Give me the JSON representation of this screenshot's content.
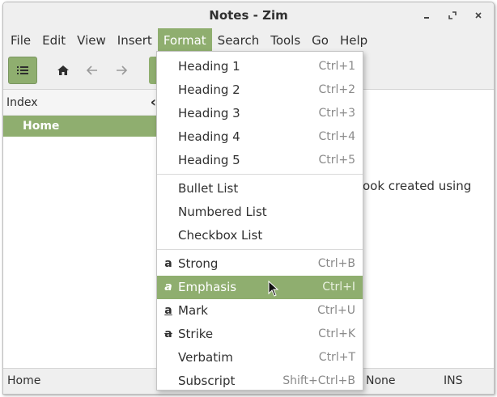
{
  "window": {
    "title": "Notes - Zim"
  },
  "menubar": {
    "items": [
      {
        "label": "File"
      },
      {
        "label": "Edit"
      },
      {
        "label": "View"
      },
      {
        "label": "Insert"
      },
      {
        "label": "Format"
      },
      {
        "label": "Search"
      },
      {
        "label": "Tools"
      },
      {
        "label": "Go"
      },
      {
        "label": "Help"
      }
    ],
    "active": "Format"
  },
  "toolbar": {
    "icons": [
      "list-icon",
      "home-icon",
      "back-arrow-icon",
      "forward-arrow-icon"
    ]
  },
  "index_pane": {
    "header": "Index",
    "pages": [
      {
        "label": "Home",
        "selected": true
      }
    ]
  },
  "editor": {
    "visible_text": "ook created using"
  },
  "statusbar": {
    "page": "Home",
    "style": "None",
    "mode": "INS"
  },
  "format_menu": {
    "groups": [
      [
        {
          "label": "Heading 1",
          "accel": "Ctrl+1"
        },
        {
          "label": "Heading 2",
          "accel": "Ctrl+2"
        },
        {
          "label": "Heading 3",
          "accel": "Ctrl+3"
        },
        {
          "label": "Heading 4",
          "accel": "Ctrl+4"
        },
        {
          "label": "Heading 5",
          "accel": "Ctrl+5"
        }
      ],
      [
        {
          "label": "Bullet List",
          "accel": ""
        },
        {
          "label": "Numbered List",
          "accel": ""
        },
        {
          "label": "Checkbox List",
          "accel": ""
        }
      ],
      [
        {
          "label": "Strong",
          "accel": "Ctrl+B",
          "icon": "strong-icon"
        },
        {
          "label": "Emphasis",
          "accel": "Ctrl+I",
          "icon": "emphasis-icon",
          "highlighted": true
        },
        {
          "label": "Mark",
          "accel": "Ctrl+U",
          "icon": "mark-icon"
        },
        {
          "label": "Strike",
          "accel": "Ctrl+K",
          "icon": "strike-icon"
        },
        {
          "label": "Verbatim",
          "accel": "Ctrl+T"
        },
        {
          "label": "Subscript",
          "accel": "Shift+Ctrl+B"
        }
      ]
    ]
  },
  "colors": {
    "accent": "#8fae6f",
    "chrome": "#efefef",
    "text": "#303030"
  }
}
